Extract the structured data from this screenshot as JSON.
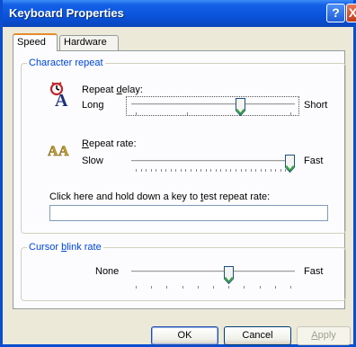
{
  "window": {
    "title": "Keyboard Properties"
  },
  "titlebar": {
    "help_glyph": "?",
    "close_glyph": "X"
  },
  "tabs": [
    {
      "label": "Speed",
      "active": true
    },
    {
      "label": "Hardware",
      "active": false
    }
  ],
  "character_repeat": {
    "legend": "Character repeat",
    "repeat_delay": {
      "label_pre": "Repeat ",
      "label_hotkey": "d",
      "label_post": "elay:",
      "min_label": "Long",
      "max_label": "Short",
      "value_fraction": 0.68,
      "icon": "repeat-delay-icon"
    },
    "repeat_rate": {
      "label_pre": "",
      "label_hotkey": "R",
      "label_post": "epeat rate:",
      "min_label": "Slow",
      "max_label": "Fast",
      "value_fraction": 1.0,
      "icon": "repeat-rate-icon"
    },
    "test": {
      "label_pre": "Click here and hold down a key to ",
      "label_hotkey": "t",
      "label_post": "est repeat rate:",
      "value": ""
    }
  },
  "cursor_blink": {
    "legend_pre": "Cursor ",
    "legend_hotkey": "b",
    "legend_post": "link rate",
    "min_label": "None",
    "max_label": "Fast",
    "value_fraction": 0.6
  },
  "buttons": {
    "ok": "OK",
    "cancel": "Cancel",
    "apply_pre": "",
    "apply_hotkey": "A",
    "apply_post": "pply"
  },
  "colors": {
    "title_bar": "#0a55db",
    "group_legend": "#0046d5",
    "tab_accent": "#e68b2c"
  }
}
